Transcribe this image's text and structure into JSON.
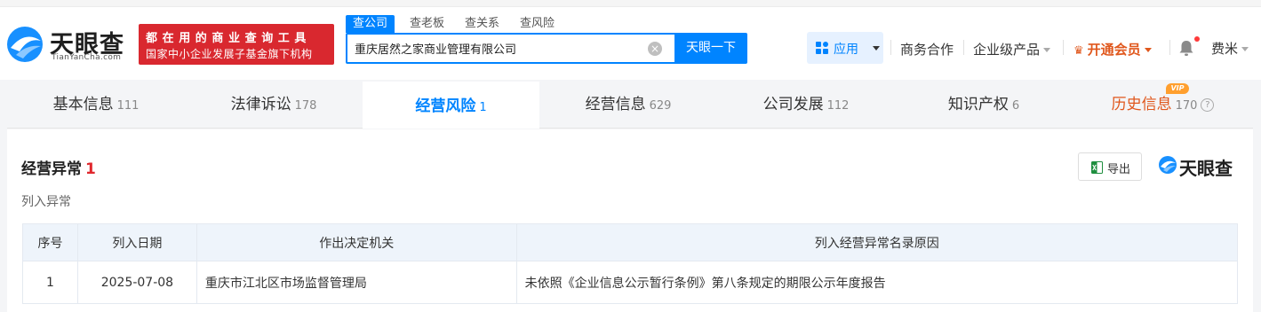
{
  "header": {
    "logo_text": "天眼查",
    "logo_sub": "TianYanCha.com",
    "slogan_line1": "都在用的商业查询工具",
    "slogan_line2": "国家中小企业发展子基金旗下机构",
    "search_tabs": [
      "查公司",
      "查老板",
      "查关系",
      "查风险"
    ],
    "search_value": "重庆居然之家商业管理有限公司",
    "search_button": "天眼一下",
    "apps_label": "应用",
    "nav_business": "商务合作",
    "nav_enterprise": "企业级产品",
    "nav_vip": "开通会员",
    "user_name": "费米"
  },
  "tabs": [
    {
      "label": "基本信息",
      "count": "111"
    },
    {
      "label": "法律诉讼",
      "count": "178"
    },
    {
      "label": "经营风险",
      "count": "1"
    },
    {
      "label": "经营信息",
      "count": "629"
    },
    {
      "label": "公司发展",
      "count": "112"
    },
    {
      "label": "知识产权",
      "count": "6"
    },
    {
      "label": "历史信息",
      "count": "170",
      "badge": "VIP"
    }
  ],
  "section": {
    "title": "经营异常",
    "count": "1",
    "subtitle": "列入异常",
    "export_label": "导出",
    "watermark": "天眼查"
  },
  "table": {
    "headers": [
      "序号",
      "列入日期",
      "作出决定机关",
      "列入经营异常名录原因"
    ],
    "rows": [
      [
        "1",
        "2025-07-08",
        "重庆市江北区市场监督管理局",
        "未依照《企业信息公示暂行条例》第八条规定的期限公示年度报告"
      ]
    ]
  },
  "colors": {
    "brand_blue": "#0084ff",
    "slogan_red": "#d9282f",
    "vip_orange": "#e0571c"
  }
}
